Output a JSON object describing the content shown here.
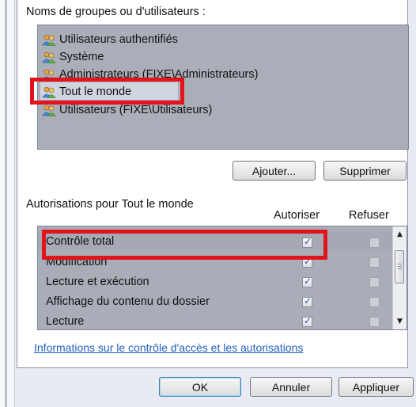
{
  "users_section": {
    "title": "Noms de groupes ou d'utilisateurs :",
    "items": [
      {
        "label": "Utilisateurs authentifiés",
        "icon": "users-group-icon"
      },
      {
        "label": "Système",
        "icon": "users-group-icon"
      },
      {
        "label": "Administrateurs (FIXE\\Administrateurs)",
        "icon": "users-group-icon"
      },
      {
        "label": "Tout le monde",
        "icon": "users-group-icon"
      },
      {
        "label": "Utilisateurs (FIXE\\Utilisateurs)",
        "icon": "users-group-icon"
      }
    ],
    "selected_index": 3,
    "add_button": "Ajouter...",
    "remove_button": "Supprimer"
  },
  "permissions_section": {
    "title": "Autorisations pour Tout le monde",
    "allow_header": "Autoriser",
    "deny_header": "Refuser",
    "rows": [
      {
        "label": "Contrôle total",
        "allow": true,
        "deny": false
      },
      {
        "label": "Modification",
        "allow": true,
        "deny": false
      },
      {
        "label": "Lecture et exécution",
        "allow": true,
        "deny": false
      },
      {
        "label": "Affichage du contenu du dossier",
        "allow": true,
        "deny": false
      },
      {
        "label": "Lecture",
        "allow": true,
        "deny": false
      }
    ]
  },
  "help_link": "Informations sur le contrôle d'accès et les autorisations",
  "footer": {
    "ok": "OK",
    "cancel": "Annuler",
    "apply": "Appliquer"
  },
  "colors": {
    "highlight_red": "#e3131b",
    "link_blue": "#1f5fbf"
  }
}
